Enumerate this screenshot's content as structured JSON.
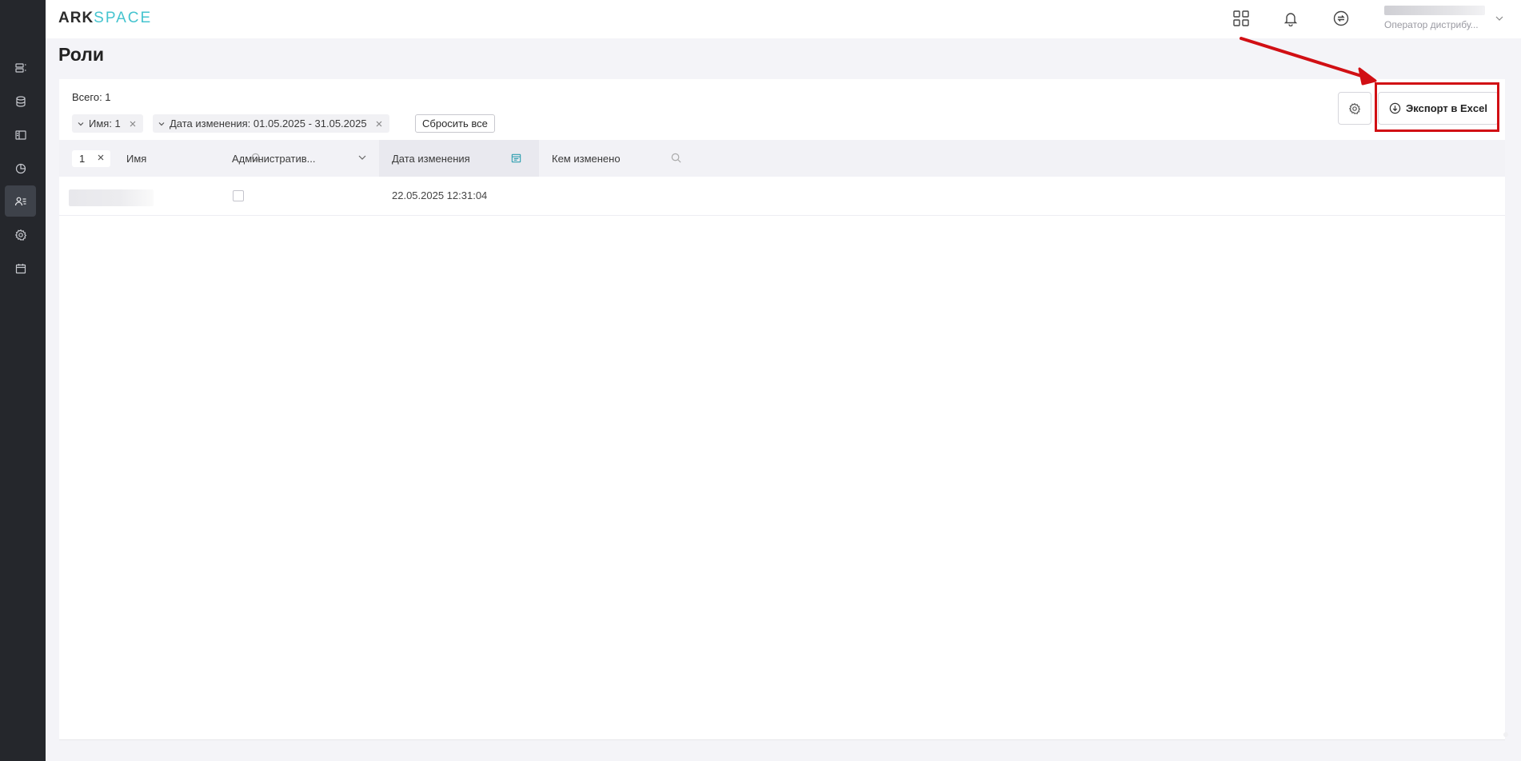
{
  "app": {
    "logo_part1": "ARK",
    "logo_part2": "SPACE"
  },
  "sidebar": {
    "items": [
      {
        "icon": "rows-icon"
      },
      {
        "icon": "database-icon"
      },
      {
        "icon": "layout-icon"
      },
      {
        "icon": "pie-chart-icon"
      },
      {
        "icon": "users-icon",
        "active": true
      },
      {
        "icon": "gear-icon"
      },
      {
        "icon": "calendar-icon"
      }
    ]
  },
  "header": {
    "user_role": "Оператор дистрибу..."
  },
  "page": {
    "title": "Роли",
    "total_label": "Всего: 1"
  },
  "filters": {
    "chips": [
      {
        "label": "Имя: 1"
      },
      {
        "label": "Дата изменения: 01.05.2025 - 31.05.2025"
      }
    ],
    "reset_label": "Сбросить все"
  },
  "toolbar": {
    "export_label": "Экспорт в Excel"
  },
  "table": {
    "page_value": "1",
    "columns": [
      {
        "label": "Имя",
        "icon": "search-icon"
      },
      {
        "label": "Административ...",
        "icon": "chevron-down-icon"
      },
      {
        "label": "Дата изменения",
        "icon": "calendar-icon",
        "sorted": true
      },
      {
        "label": "Кем изменено",
        "icon": "search-icon"
      }
    ],
    "rows": [
      {
        "name": "",
        "admin": false,
        "date": "22.05.2025 12:31:04",
        "changed_by": ""
      }
    ]
  },
  "annotation": {
    "color": "#d10f14"
  }
}
